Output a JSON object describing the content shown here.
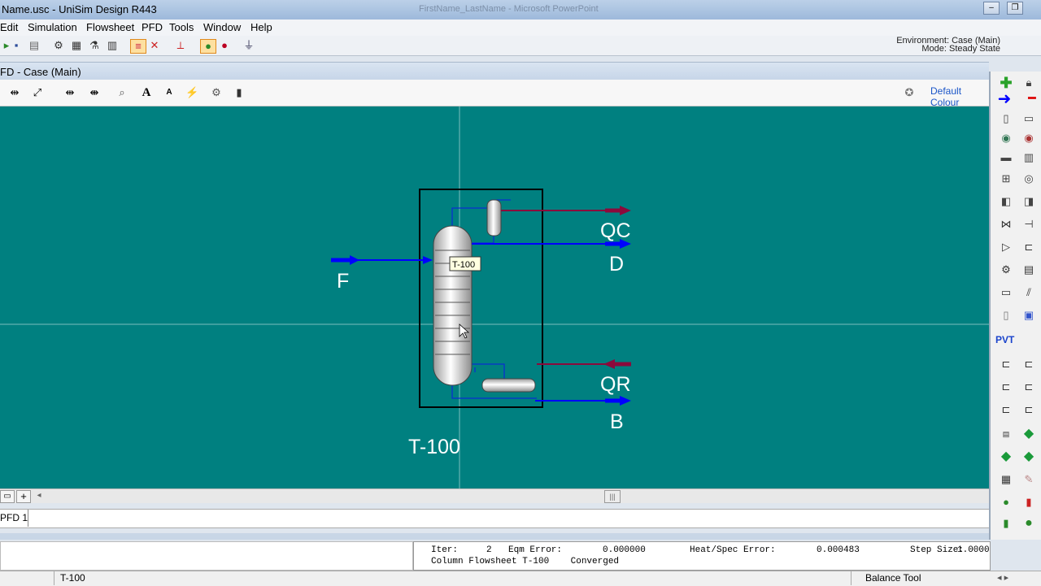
{
  "window": {
    "title": "Name.usc - UniSim Design R443",
    "background_app": "FirstName_LastName - Microsoft PowerPoint",
    "controls": [
      "–",
      "❐"
    ]
  },
  "menu": [
    "Edit",
    "Simulation",
    "Flowsheet",
    "PFD",
    "Tools",
    "Window",
    "Help"
  ],
  "environment": {
    "case": "Environment: Case (Main)",
    "mode": "Mode: Steady State"
  },
  "pfd": {
    "title": "FD - Case (Main)",
    "colour_scheme": "Default Colour",
    "tab": "PFD 1",
    "canvas_color": "#008080"
  },
  "flowsheet": {
    "column_name": "T-100",
    "tooltip": "T-100",
    "streams": {
      "feed": "F",
      "condenser_duty": "QC",
      "distillate": "D",
      "reboiler_duty": "QR",
      "bottoms": "B"
    },
    "material_stream_color": "#0000ff",
    "energy_stream_color": "#8b0a3c"
  },
  "solver": {
    "iter_label": "Iter:",
    "iter_value": "2",
    "eqm_label": "Eqm Error:",
    "eqm_value": "0.000000",
    "heat_label": "Heat/Spec Error:",
    "heat_value": "0.000483",
    "step_label": "Step Size:",
    "step_value": "1.0000",
    "message": "Column Flowsheet T-100    Converged"
  },
  "statusbar": {
    "object": "T-100",
    "tool": "Balance Tool",
    "nav": "◂ ▸"
  }
}
